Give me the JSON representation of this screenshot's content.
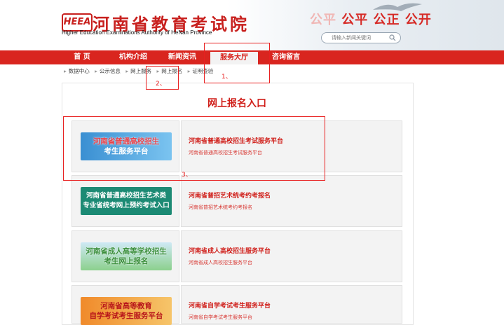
{
  "header": {
    "logo_badge": "HEEA",
    "logo_title": "河南省教育考试院",
    "logo_subtitle": "Higher Education Examinations Authority of HeNan Province",
    "slogan_ghost": "公平",
    "slogan_main": "公平 公正 公开",
    "search_placeholder": "请输入新闻关键词"
  },
  "nav": {
    "items": [
      {
        "label": "首 页"
      },
      {
        "label": "机构介绍"
      },
      {
        "label": "新闻资讯"
      },
      {
        "label": "服务大厅"
      },
      {
        "label": "咨询留言"
      }
    ],
    "active_index": 3
  },
  "breadcrumb": [
    "数据中心",
    "公示信息",
    "网上服务",
    "网上报名",
    "证明查验"
  ],
  "page_title": "网上报名入口",
  "entries": [
    {
      "banner_line1": "河南省普通高校招生",
      "banner_line2": "考生服务平台",
      "title": "河南省普通高校招生考试服务平台",
      "subtitle": "河南省普通高校招生考试服务平台"
    },
    {
      "banner_line1": "河南省普通高校招生艺术类",
      "banner_line2": "专业省统考网上预约考试入口",
      "title": "河南省普招艺术统考约考报名",
      "subtitle": "河南省普招艺术统考约考报名"
    },
    {
      "banner_line1": "河南省成人高等学校招生",
      "banner_line2": "考生网上报名",
      "title": "河南省成人高校招生服务平台",
      "subtitle": "河南省成人高校招生服务平台"
    },
    {
      "banner_line1": "河南省高等教育",
      "banner_line2": "自学考试考生服务平台",
      "title": "河南省自学考试考生服务平台",
      "subtitle": "河南省自学考试考生服务平台"
    }
  ],
  "annotations": [
    "1、",
    "2、",
    "3、"
  ],
  "colors": {
    "brand_red": "#d9251f",
    "annotation_red": "#e82020"
  }
}
